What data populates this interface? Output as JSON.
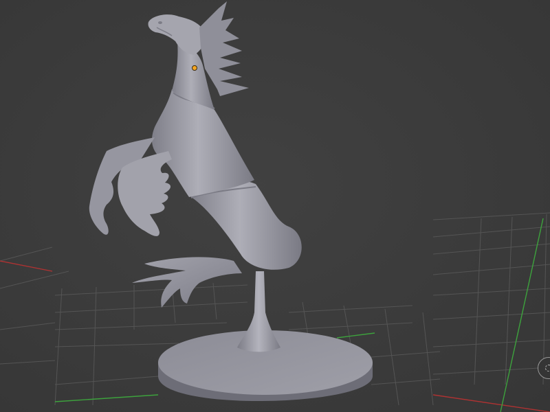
{
  "viewport": {
    "view": "perspective",
    "shading": "solid",
    "grid_visible": true,
    "background_color": "#3d3d3d",
    "grid_color": "#555555",
    "x_axis_color": "#b03232",
    "y_axis_color": "#3da33d",
    "object_color": "#9a9aa4"
  },
  "scene": {
    "object": "seahorse-statue-mesh",
    "origin_point_color": "#f5a623",
    "gizmo": "navigation-gizmo-icon"
  }
}
